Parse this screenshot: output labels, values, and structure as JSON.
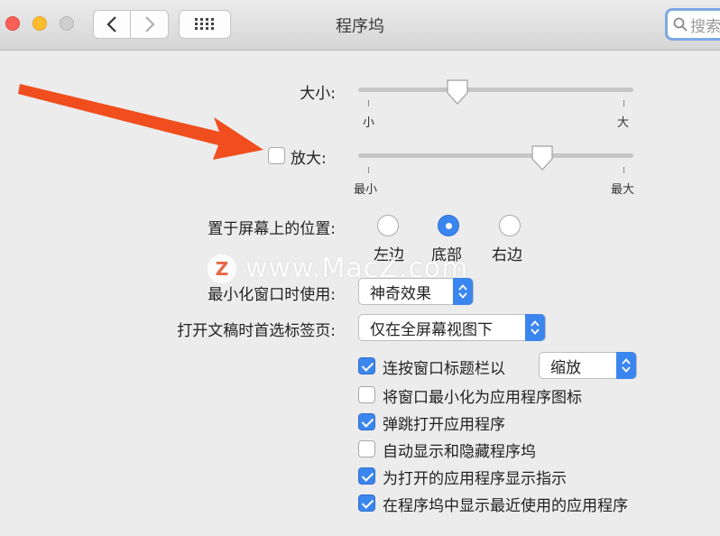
{
  "window": {
    "title": "程序坞"
  },
  "search": {
    "placeholder": "搜索"
  },
  "size": {
    "label": "大小:",
    "min_label": "小",
    "max_label": "大",
    "value_fraction": 0.36
  },
  "magnification": {
    "label": "放大:",
    "checked": false,
    "min_label": "最小",
    "max_label": "最大",
    "value_fraction": 0.67
  },
  "position": {
    "label": "置于屏幕上的位置:",
    "options": [
      {
        "label": "左边",
        "selected": false
      },
      {
        "label": "底部",
        "selected": true
      },
      {
        "label": "右边",
        "selected": false
      }
    ]
  },
  "minimize_effect": {
    "label": "最小化窗口时使用:",
    "value": "神奇效果"
  },
  "prefer_tabs": {
    "label": "打开文稿时首选标签页:",
    "value": "仅在全屏幕视图下"
  },
  "double_click": {
    "label": "连按窗口标题栏以",
    "checked": true,
    "value": "缩放"
  },
  "checkboxes": [
    {
      "label": "将窗口最小化为应用程序图标",
      "checked": false
    },
    {
      "label": "弹跳打开应用程序",
      "checked": true
    },
    {
      "label": "自动显示和隐藏程序坞",
      "checked": false
    },
    {
      "label": "为打开的应用程序显示指示",
      "checked": true
    },
    {
      "label": "在程序坞中显示最近使用的应用程序",
      "checked": true
    }
  ],
  "watermark": {
    "logo": "Z",
    "text": "www.MacZ.com"
  },
  "colors": {
    "accent": "#3b86ee",
    "arrow": "#f04e1e"
  }
}
